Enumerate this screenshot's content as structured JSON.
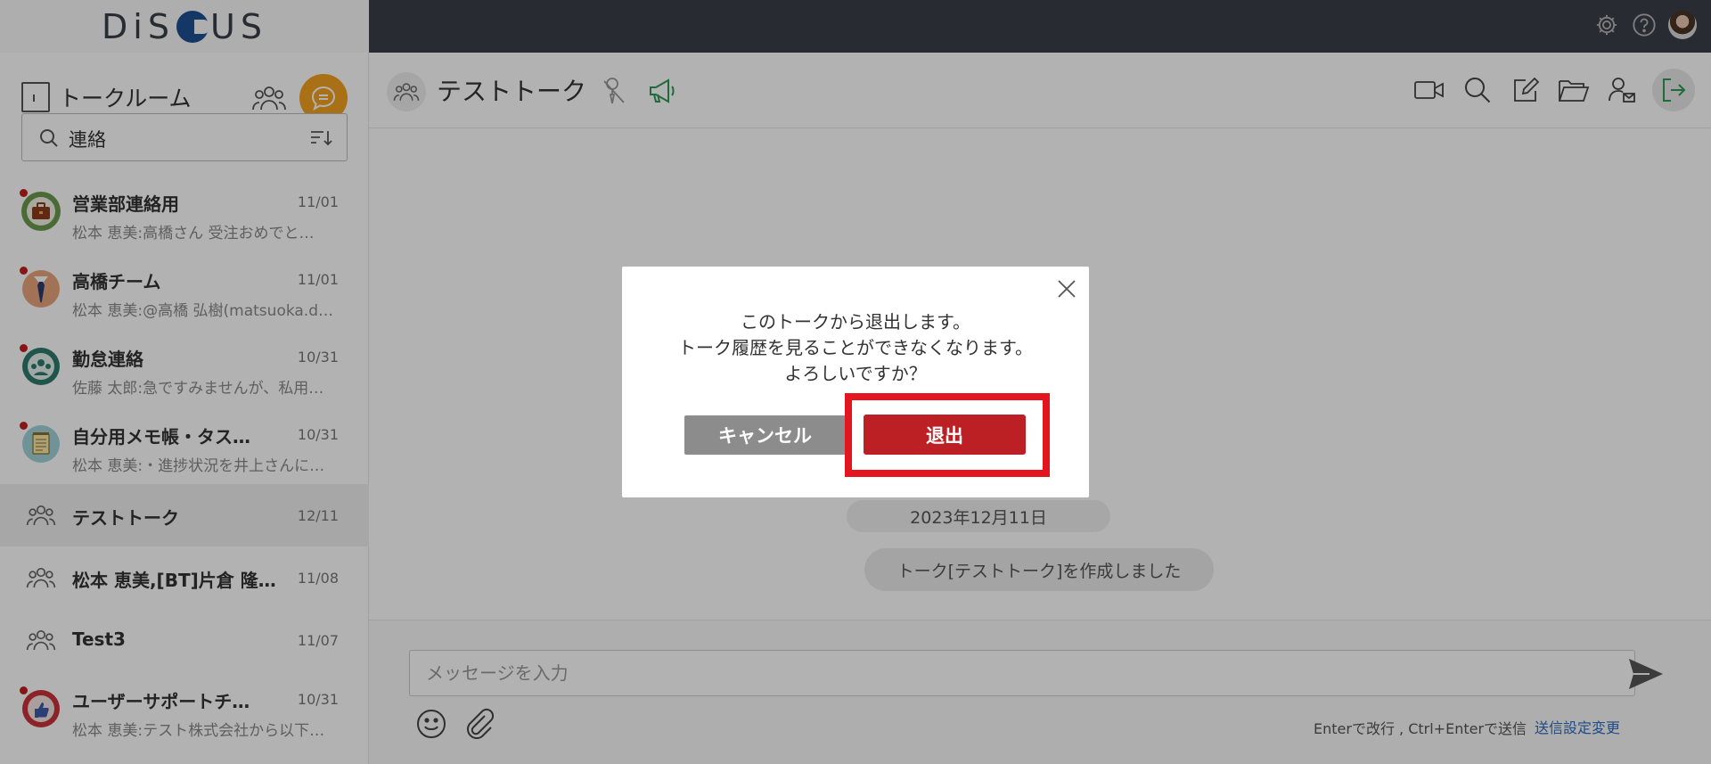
{
  "app": {
    "logo_text_left": "DiS",
    "logo_text_right": "US"
  },
  "sidebar": {
    "title": "トークルーム",
    "search_value": "連絡",
    "talks": [
      {
        "name": "営業部連絡用",
        "date": "11/01",
        "preview": "松本 恵美:高橋さん 受注おめでと…",
        "unread": true,
        "avatar": "briefcase"
      },
      {
        "name": "高橋チーム",
        "date": "11/01",
        "preview": "松本 恵美:@高橋 弘樹(matsuoka.d…",
        "unread": true,
        "avatar": "tie"
      },
      {
        "name": "勤怠連絡",
        "date": "10/31",
        "preview": "佐藤 太郎:急ですみませんが、私用…",
        "unread": true,
        "avatar": "team"
      },
      {
        "name": "自分用メモ帳・タス…",
        "date": "10/31",
        "preview": "松本 恵美:・進捗状況を井上さんに…",
        "unread": true,
        "avatar": "notepad"
      },
      {
        "name": "テストトーク",
        "date": "12/11",
        "preview": "",
        "unread": false,
        "avatar": "group"
      },
      {
        "name": "松本 恵美,[BT]片倉 隆…",
        "date": "11/08",
        "preview": "",
        "unread": false,
        "avatar": "group"
      },
      {
        "name": "Test3",
        "date": "11/07",
        "preview": "",
        "unread": false,
        "avatar": "group"
      },
      {
        "name": "ユーザーサポートチ…",
        "date": "10/31",
        "preview": "松本 恵美:テスト株式会社から以下…",
        "unread": true,
        "avatar": "thumbsup"
      }
    ]
  },
  "main": {
    "room_title": "テストトーク",
    "date_label": "2023年12月11日",
    "system_message": "トーク[テストトーク]を作成しました",
    "input_placeholder": "メッセージを入力",
    "hint": "Enterで改行 , Ctrl+Enterで送信",
    "send_setting_link": "送信設定変更"
  },
  "dialog": {
    "line1": "このトークから退出します。",
    "line2": "トーク履歴を見ることができなくなります。",
    "line3": "よろしいですか？",
    "cancel_label": "キャンセル",
    "leave_label": "退出"
  },
  "colors": {
    "accent_orange": "#f2a11f",
    "danger_red": "#bd2024",
    "highlight_red": "#e3151e",
    "topbar": "#3a3e48",
    "link_blue": "#2b6cc4"
  }
}
